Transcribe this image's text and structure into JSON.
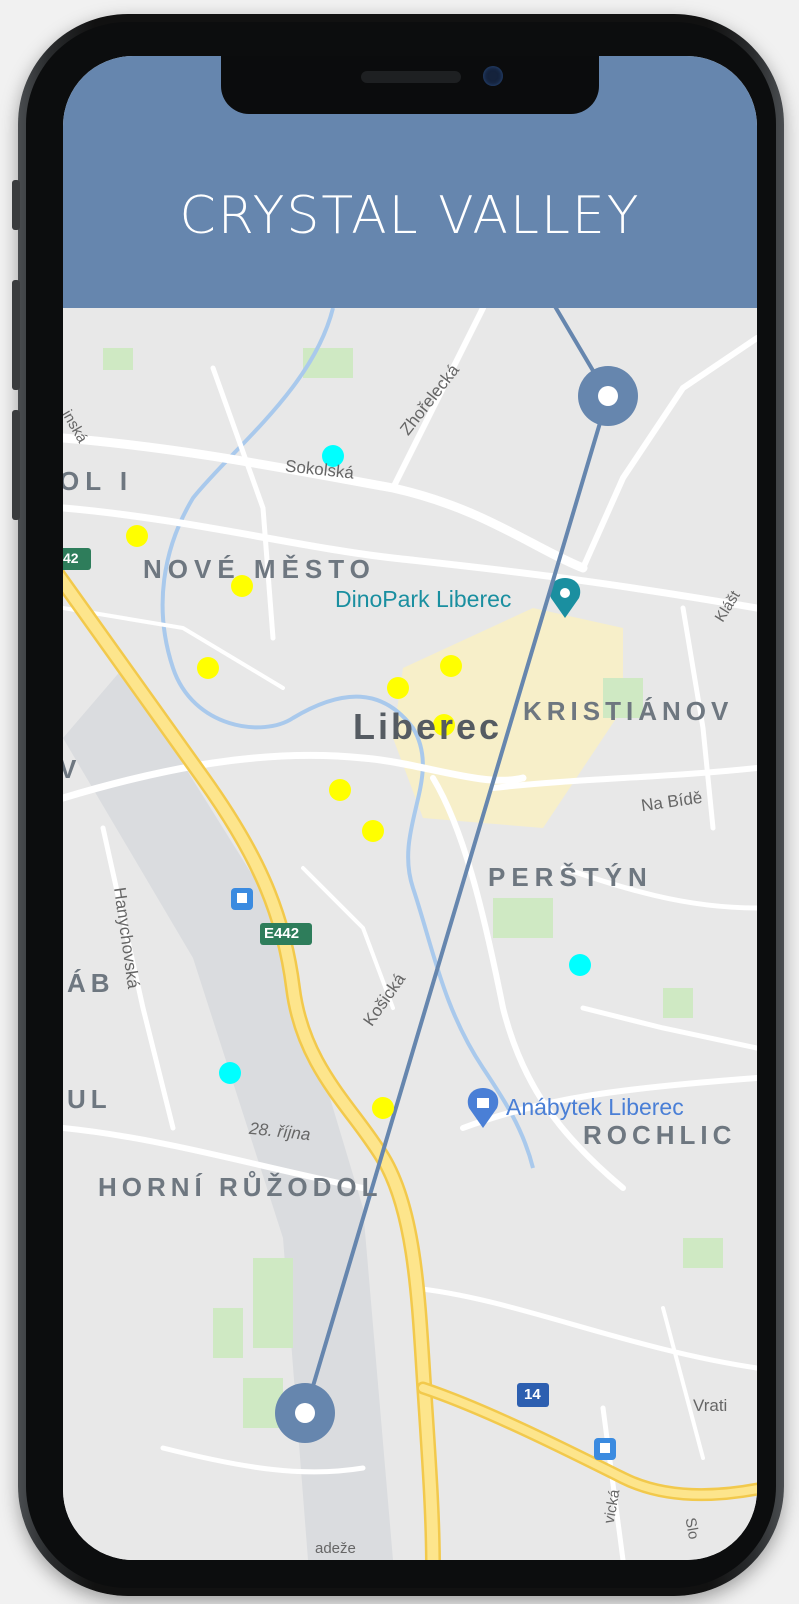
{
  "app": {
    "title": "CRYSTAL VALLEY",
    "header_color": "#6686ae",
    "route_color": "#6686ae"
  },
  "map": {
    "places": {
      "nove_mesto": "NOVÉ MĚSTO",
      "liberec": "Liberec",
      "kristianov": "KRISTIÁNOV",
      "perstyn": "PERŠTÝN",
      "horni_ruzodol": "HORNÍ RŮŽODOL",
      "rochlice": "ROCHLIC",
      "edge_1": "OL I",
      "edge_2": "V",
      "edge_3": "ÁB",
      "edge_4": "UL"
    },
    "streets": {
      "sokolska": "Sokolská",
      "zhorelecka": "Zhořelecká",
      "na_bide": "Na Bídě",
      "hanychovska": "Hanychovská",
      "kosicka": "Košická",
      "ctyricet_osm": "28. října",
      "vrati": "Vrati",
      "klast": "Klášt",
      "left_top": "inská",
      "bottom_1": "vická",
      "bottom_2": "Slo",
      "bottom_3": "adeže"
    },
    "pois": {
      "dinopark": "DinoPark Liberec",
      "anabytek": "Anábytek Liberec"
    },
    "road_shields": {
      "e442_a": "E442",
      "e442_b": "42",
      "route_14": "14"
    },
    "markers": {
      "yellow": "#ffff00",
      "cyan": "#00ffff"
    }
  }
}
